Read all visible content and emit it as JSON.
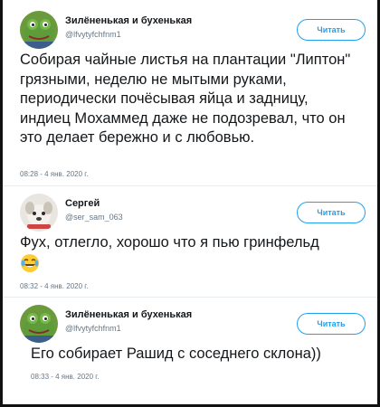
{
  "tweets": [
    {
      "name": "Зилёненькая и бухенькая",
      "handle": "@lfvytyfchfnm1",
      "follow_label": "Читать",
      "text": "Собирая чайные листья на плантации \"Липтон\" грязными, неделю не мытыми руками, периодически почёсывая яйца и задницу, индиец Мохаммед даже не подозревал, что он это делает бережно и с любовью.",
      "time": "08:28 - 4 янв. 2020 г."
    },
    {
      "name": "Сергей",
      "handle": "@ser_sam_063",
      "follow_label": "Читать",
      "text": "Фух, отлегло, хорошо что я пью гринфельд",
      "time": "08:32 - 4 янв. 2020 г."
    },
    {
      "name": "Зилёненькая и бухенькая",
      "handle": "@lfvytyfchfnm1",
      "follow_label": "Читать",
      "text": "Его собирает Рашид с соседнего склона))",
      "time": "08:33 - 4 янв. 2020 г."
    }
  ],
  "colors": {
    "accent": "#1da1f2",
    "secondary_text": "#657786",
    "divider": "#e6ecf0"
  },
  "icons": [
    "frog-avatar-icon",
    "dog-avatar-icon",
    "crying-laughing-emoji-icon"
  ]
}
